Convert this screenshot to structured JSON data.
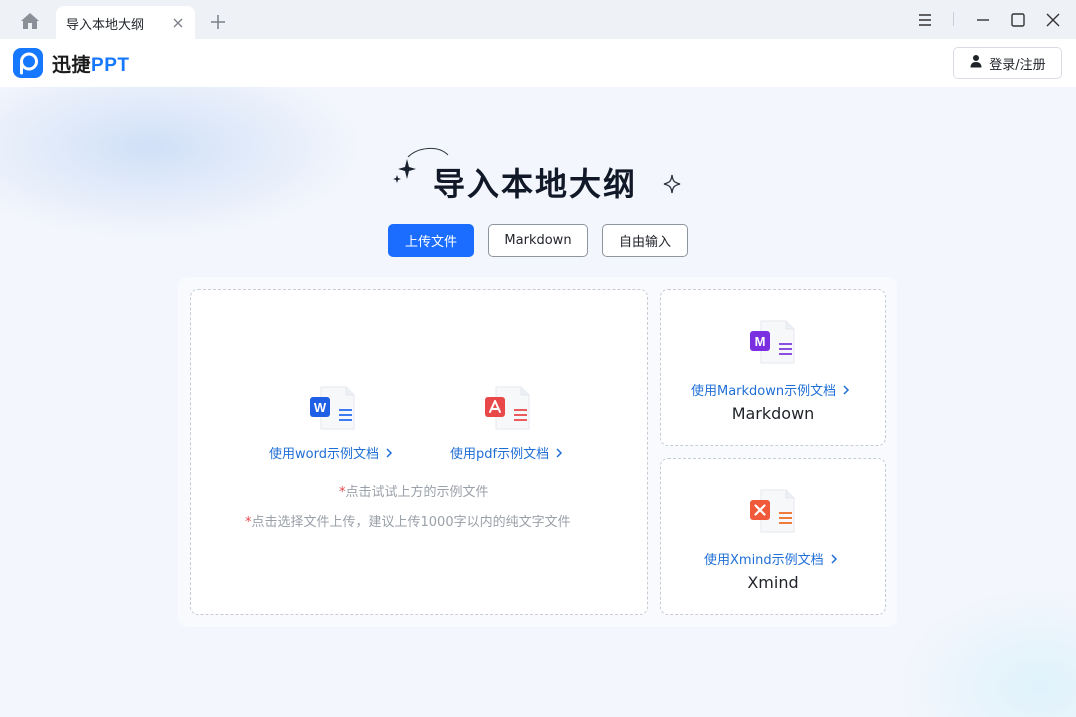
{
  "tabbar": {
    "home_icon": "home-icon",
    "active_tab": {
      "title": "导入本地大纲",
      "close_icon": "close-icon"
    },
    "new_tab_icon": "plus-icon",
    "window_controls": [
      "menu-icon",
      "minimize-icon",
      "maximize-icon",
      "close-icon"
    ]
  },
  "header": {
    "logo_text_cn": "迅捷",
    "logo_text_en": "PPT",
    "login_label": "登录/注册",
    "accent_color": "#1677ff"
  },
  "main": {
    "title": "导入本地大纲",
    "modes": [
      {
        "label": "上传文件",
        "active": true
      },
      {
        "label": "Markdown",
        "active": false
      },
      {
        "label": "自由输入",
        "active": false
      }
    ],
    "upload": {
      "word_link": "使用word示例文档",
      "pdf_link": "使用pdf示例文档",
      "hint_1_star": "*",
      "hint_1": "点击试试上方的示例文件",
      "hint_2_star": "*",
      "hint_2": "点击选择文件上传，建议上传1000字以内的纯文字文件"
    },
    "markdown_card": {
      "link": "使用Markdown示例文档",
      "label": "Markdown",
      "icon_letter": "M"
    },
    "xmind_card": {
      "link": "使用Xmind示例文档",
      "label": "Xmind"
    },
    "word_icon_letter": "W"
  }
}
